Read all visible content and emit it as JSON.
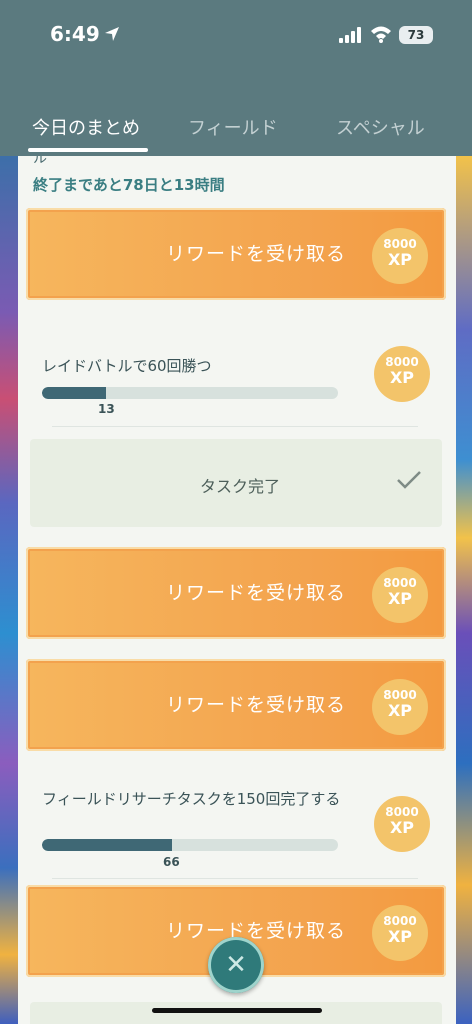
{
  "status": {
    "time": "6:49",
    "battery": "73"
  },
  "tabs": [
    {
      "label": "今日のまとめ",
      "active": true
    },
    {
      "label": "フィールド",
      "active": false
    },
    {
      "label": "スペシャル",
      "active": false
    }
  ],
  "panel": {
    "truncated_text": "ル",
    "countdown": "終了まであと78日と13時間"
  },
  "rewards": [
    {
      "label": "リワードを受け取る",
      "xp_amount": "8000",
      "xp_unit": "XP"
    },
    {
      "label": "リワードを受け取る",
      "xp_amount": "8000",
      "xp_unit": "XP"
    },
    {
      "label": "リワードを受け取る",
      "xp_amount": "8000",
      "xp_unit": "XP"
    },
    {
      "label": "リワードを受け取る",
      "xp_amount": "8000",
      "xp_unit": "XP"
    }
  ],
  "tasks": [
    {
      "title": "レイドバトルで60回勝つ",
      "progress_value": 13,
      "progress_max": 60,
      "progress_label": "13",
      "xp_amount": "8000",
      "xp_unit": "XP"
    },
    {
      "title": "フィールドリサーチタスクを150回完了する",
      "progress_value": 66,
      "progress_max": 150,
      "progress_label": "66",
      "xp_amount": "8000",
      "xp_unit": "XP"
    }
  ],
  "completed": {
    "label": "タスク完了"
  },
  "colors": {
    "accent_orange": "#f3a24d",
    "header_teal": "#5b7a7f",
    "xp_gold": "#f3c46a",
    "progress_fill": "#3f6875"
  }
}
